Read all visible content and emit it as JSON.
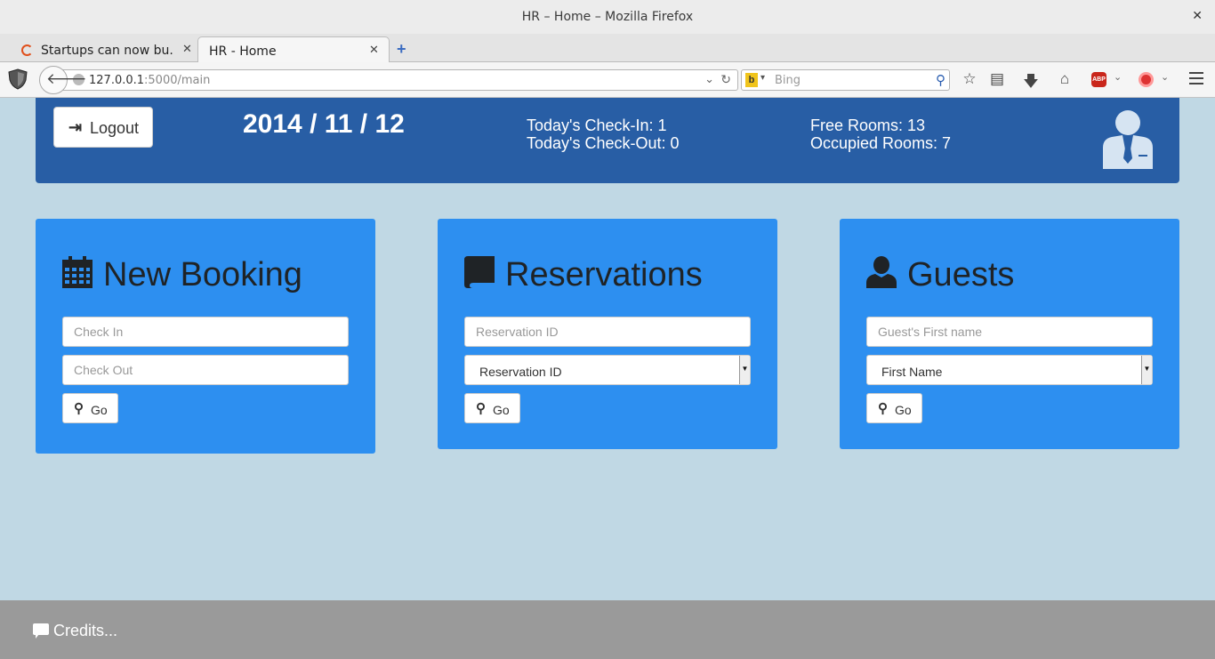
{
  "browser": {
    "window_title": "HR – Home – Mozilla Firefox",
    "window_close": "✕",
    "tabs": [
      {
        "label": "Startups can now bu...",
        "close": "✕"
      },
      {
        "label": "HR - Home",
        "close": "✕"
      }
    ],
    "new_tab": "+",
    "url_host": "127.0.0.1",
    "url_path": ":5000/main",
    "search_placeholder": "Bing",
    "icons": [
      "shield-icon",
      "back-arrow-icon",
      "reload-icon",
      "star-icon",
      "reading-list-icon",
      "download-icon",
      "home-icon",
      "adblock-icon",
      "extension-icon",
      "menu-icon"
    ]
  },
  "header": {
    "logout_label": "Logout",
    "date": "2014 / 11 / 12",
    "checkin": "Today's Check-In: 1",
    "checkout": "Today's Check-Out: 0",
    "free_rooms": "Free Rooms: 13",
    "occupied_rooms": "Occupied Rooms: 7"
  },
  "panels": [
    {
      "title": "New Booking",
      "icon": "calendar-icon",
      "checkin_placeholder": "Check In",
      "checkout_placeholder": "Check Out",
      "go_label": "Go"
    },
    {
      "title": "Reservations",
      "icon": "book-icon",
      "input_placeholder": "Reservation ID",
      "select_value": "Reservation ID",
      "go_label": "Go"
    },
    {
      "title": "Guests",
      "icon": "user-icon",
      "input_placeholder": "Guest's First name",
      "select_value": "First Name",
      "go_label": "Go"
    }
  ],
  "footer": {
    "credits": "Credits..."
  },
  "colors": {
    "page_bg": "#c0d8e4",
    "header_bg": "#285ea5",
    "panel_bg": "#2d8ff0",
    "footer_bg": "#9a9a9a"
  }
}
